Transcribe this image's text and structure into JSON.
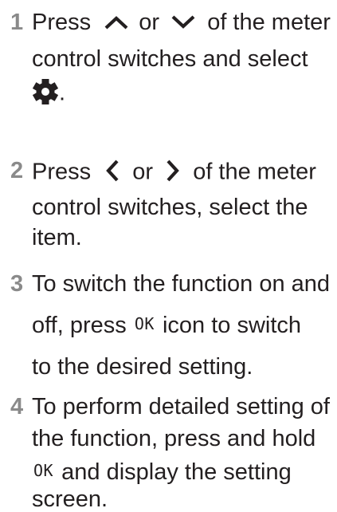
{
  "steps": [
    {
      "number": "1",
      "text1": "Press",
      "icon_up": "chevron-up-icon",
      "or": "or",
      "icon_down": "chevron-down-icon",
      "text2": "of the meter",
      "line2": "control switches and select",
      "icon_gear": "gear-icon",
      "period": "."
    },
    {
      "number": "2",
      "text1": "Press",
      "icon_left": "chevron-left-icon",
      "or": "or",
      "icon_right": "chevron-right-icon",
      "text2": "of the meter",
      "line2": "control switches, select the",
      "line3": "item."
    },
    {
      "number": "3",
      "line1": "To switch the function on and",
      "text_before_ok": "off, press",
      "ok": "OK",
      "text_after_ok": "icon to switch",
      "line3": "to the desired setting."
    },
    {
      "number": "4",
      "line1": "To perform detailed setting of",
      "line2": "the function, press and hold",
      "ok": "OK",
      "text_after_ok": "and display the setting",
      "line4": "screen."
    }
  ]
}
